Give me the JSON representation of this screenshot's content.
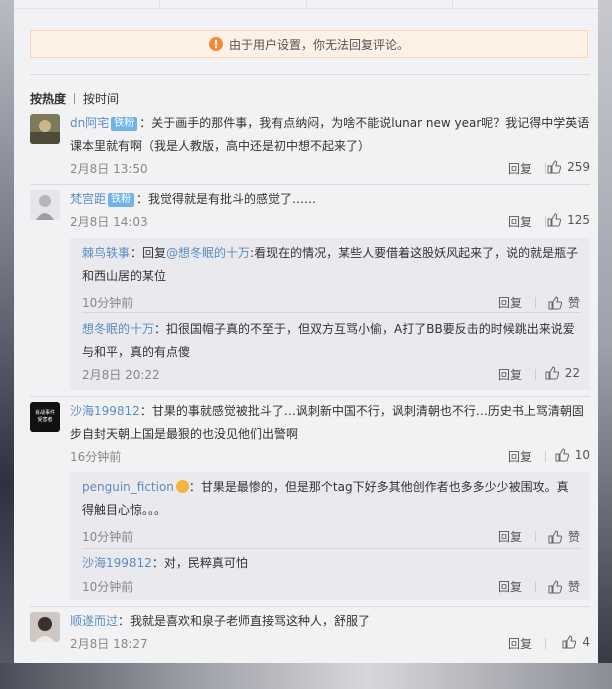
{
  "notice": {
    "text": "由于用户设置，你无法回复评论。"
  },
  "sort": {
    "hot": "按热度",
    "time": "按时间"
  },
  "reply_label": "回复",
  "zan_label": "赞",
  "comments": [
    {
      "user": "dn阿宅",
      "badge": "铁粉",
      "text": "：关于画手的那件事，我有点纳闷，为啥不能说lunar new year呢？我记得中学英语课本里就有啊（我是人教版，高中还是初中想不起来了）",
      "time": "2月8日 13:50",
      "likes": "259"
    },
    {
      "user": "梵宫距",
      "badge": "铁粉",
      "text": "：我觉得就是有批斗的感觉了……",
      "time": "2月8日 14:03",
      "likes": "125",
      "replies": [
        {
          "user": "棘鸟轶事",
          "prefix": "：回复",
          "mention": "@想冬眠的十万",
          "text": ":看现在的情况，某些人要借着这股妖风起来了，说的就是瓶子和西山居的某位",
          "time": "10分钟前",
          "likes": "赞"
        },
        {
          "user": "想冬眠的十万",
          "text": "：扣很国帽子真的不至于，但双方互骂小偷，A打了BB要反击的时候跳出来说爱与和平，真的有点傻",
          "time": "2月8日 20:22",
          "likes": "22"
        }
      ]
    },
    {
      "user": "沙海199812",
      "avatar_text": [
        "肖战事件",
        "受害者"
      ],
      "text": "：甘果的事就感觉被批斗了…讽刺新中国不行，讽刺清朝也不行…历史书上骂清朝固步自封天朝上国是最狠的也没见他们出警啊",
      "time": "16分钟前",
      "likes": "10",
      "replies": [
        {
          "user": "penguin_fiction",
          "text": "：甘果是最惨的，但是那个tag下好多其他创作者也多多少少被围攻。真得触目心惊。。。",
          "time": "10分钟前",
          "likes": "赞"
        },
        {
          "user": "沙海199812",
          "text": "：对，民粹真可怕",
          "time": "10分钟前",
          "likes": "赞"
        }
      ]
    },
    {
      "user": "顺遂而过",
      "text": "：我就是喜欢和泉子老师直接骂这种人，舒服了",
      "time": "2月8日 18:27",
      "likes": "4"
    }
  ],
  "colors": {
    "link": "#5b8dbf",
    "badge": "#6fb3e8",
    "warn": "#f08c3c"
  }
}
